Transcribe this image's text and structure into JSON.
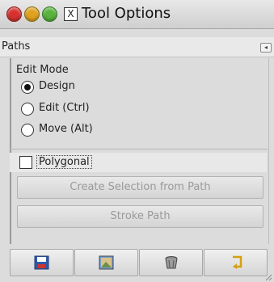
{
  "window": {
    "title": "Tool Options",
    "x_icon": "X"
  },
  "panel": {
    "title": "Paths",
    "menu_icon": "◂",
    "edit_mode_label": "Edit Mode",
    "modes": [
      {
        "label": "Design",
        "selected": true
      },
      {
        "label": "Edit (Ctrl)",
        "selected": false
      },
      {
        "label": "Move (Alt)",
        "selected": false
      }
    ],
    "polygonal": {
      "label": "Polygonal",
      "checked": false
    },
    "buttons": {
      "create_selection": "Create Selection from Path",
      "stroke_path": "Stroke Path"
    }
  },
  "toolbar": {
    "icons": [
      "save-icon",
      "restore-icon",
      "delete-icon",
      "reset-icon"
    ]
  }
}
